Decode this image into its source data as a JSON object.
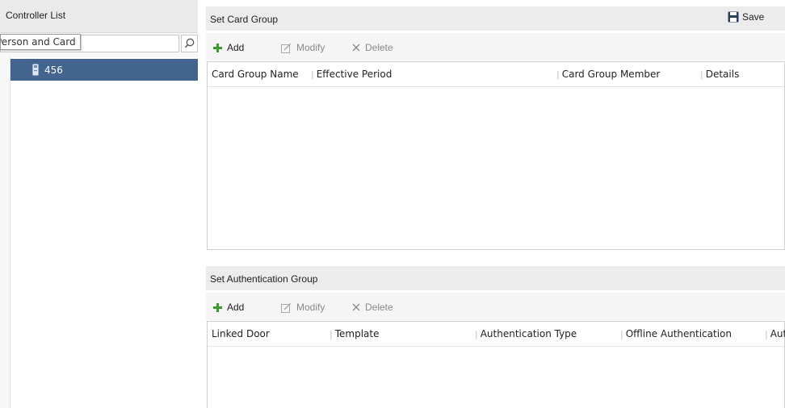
{
  "left": {
    "title": "Controller List",
    "search_value": "Person and Card",
    "tooltip": "Person and Card",
    "tree": [
      {
        "label": "456",
        "icon": "controller-icon"
      }
    ]
  },
  "card_group": {
    "title": "Set Card Group",
    "save_label": "Save",
    "toolbar": {
      "add": "Add",
      "modify": "Modify",
      "delete": "Delete"
    },
    "columns": [
      "Card Group Name",
      "Effective Period",
      "Card Group Member",
      "Details"
    ]
  },
  "auth_group": {
    "title": "Set Authentication Group",
    "toolbar": {
      "add": "Add",
      "modify": "Modify",
      "delete": "Delete"
    },
    "columns": [
      "Linked Door",
      "Template",
      "Authentication Type",
      "Offline Authentication",
      "Aut"
    ]
  },
  "colors": {
    "selection": "#43648e",
    "add_icon": "#3a9a2e",
    "header_bg": "#ececec"
  }
}
